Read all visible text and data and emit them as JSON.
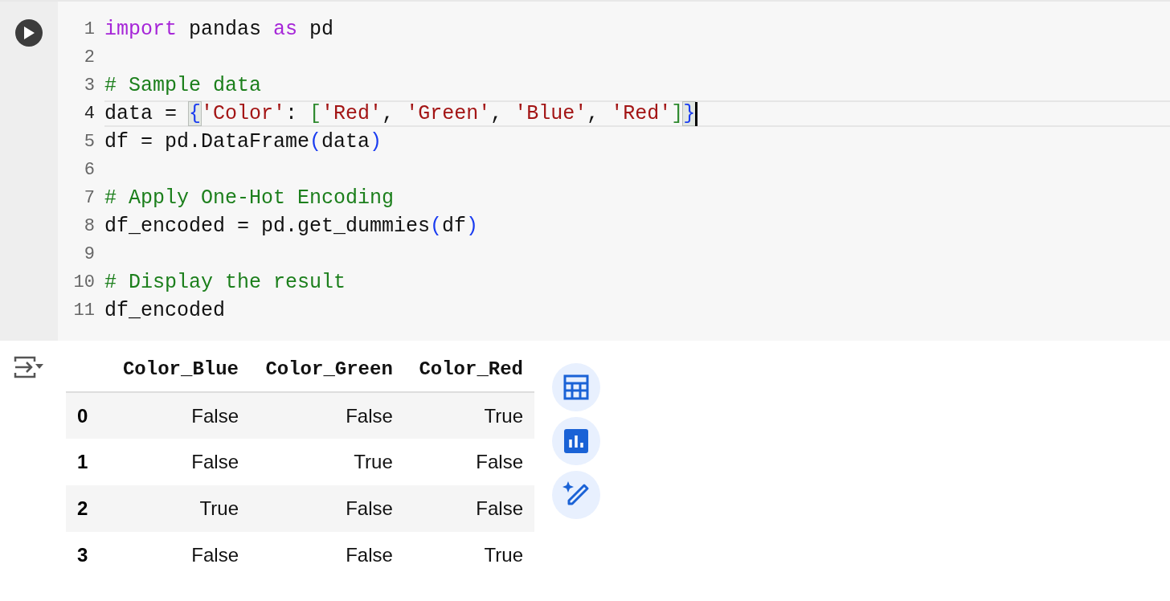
{
  "code_cell": {
    "lines": [
      {
        "number": "1",
        "active": false,
        "tokens": [
          {
            "text": "import",
            "kind": "keyword"
          },
          {
            "text": " pandas ",
            "kind": "plain"
          },
          {
            "text": "as",
            "kind": "keyword"
          },
          {
            "text": " pd",
            "kind": "plain"
          }
        ]
      },
      {
        "number": "2",
        "active": false
      },
      {
        "number": "3",
        "active": false,
        "tokens": [
          {
            "text": "# Sample data",
            "kind": "comment"
          }
        ]
      },
      {
        "number": "4",
        "active": true,
        "tokens": [
          {
            "text": "data = ",
            "kind": "plain"
          },
          {
            "text": "{",
            "kind": "matched-brace"
          },
          {
            "text": "'Color'",
            "kind": "string"
          },
          {
            "text": ": ",
            "kind": "plain"
          },
          {
            "text": "[",
            "kind": "bracket"
          },
          {
            "text": "'Red'",
            "kind": "string"
          },
          {
            "text": ", ",
            "kind": "plain"
          },
          {
            "text": "'Green'",
            "kind": "string"
          },
          {
            "text": ", ",
            "kind": "plain"
          },
          {
            "text": "'Blue'",
            "kind": "string"
          },
          {
            "text": ", ",
            "kind": "plain"
          },
          {
            "text": "'Red'",
            "kind": "string"
          },
          {
            "text": "]",
            "kind": "bracket"
          },
          {
            "text": "}",
            "kind": "matched-brace"
          }
        ]
      },
      {
        "number": "5",
        "active": false,
        "tokens": [
          {
            "text": "df = pd.DataFrame",
            "kind": "plain"
          },
          {
            "text": "(",
            "kind": "brace"
          },
          {
            "text": "data",
            "kind": "plain"
          },
          {
            "text": ")",
            "kind": "brace"
          }
        ]
      },
      {
        "number": "6",
        "active": false
      },
      {
        "number": "7",
        "active": false,
        "tokens": [
          {
            "text": "# Apply One-Hot Encoding",
            "kind": "comment"
          }
        ]
      },
      {
        "number": "8",
        "active": false,
        "tokens": [
          {
            "text": "df_encoded = pd.get_dummies",
            "kind": "plain"
          },
          {
            "text": "(",
            "kind": "brace"
          },
          {
            "text": "df",
            "kind": "plain"
          },
          {
            "text": ")",
            "kind": "brace"
          }
        ]
      },
      {
        "number": "9",
        "active": false
      },
      {
        "number": "10",
        "active": false,
        "tokens": [
          {
            "text": "# Display the result",
            "kind": "comment"
          }
        ]
      },
      {
        "number": "11",
        "active": false,
        "tokens": [
          {
            "text": "df_encoded",
            "kind": "plain"
          }
        ]
      }
    ]
  },
  "output": {
    "table": {
      "columns": [
        "Color_Blue",
        "Color_Green",
        "Color_Red"
      ],
      "rows": [
        {
          "index": "0",
          "cells": [
            "False",
            "False",
            "True"
          ]
        },
        {
          "index": "1",
          "cells": [
            "False",
            "True",
            "False"
          ]
        },
        {
          "index": "2",
          "cells": [
            "True",
            "False",
            "False"
          ]
        },
        {
          "index": "3",
          "cells": [
            "False",
            "False",
            "True"
          ]
        }
      ]
    }
  }
}
